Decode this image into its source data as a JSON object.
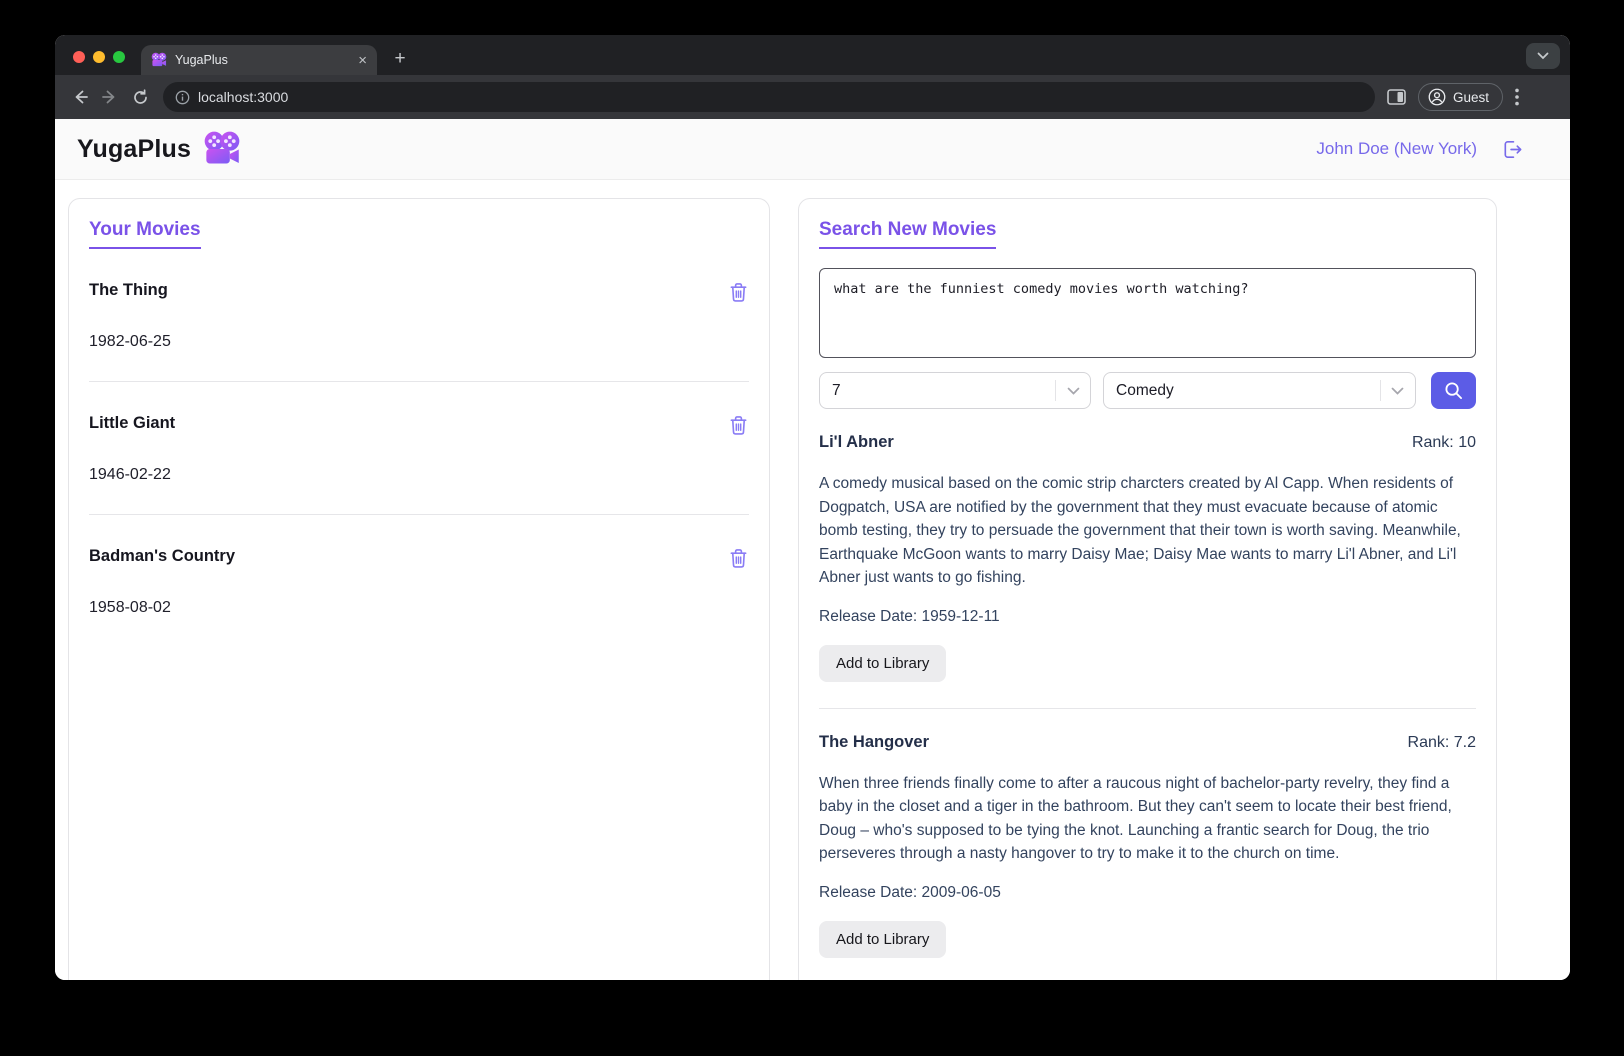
{
  "browser": {
    "tab_title": "YugaPlus",
    "tab_close": "×",
    "new_tab": "+",
    "url": "localhost:3000",
    "profile_label": "Guest"
  },
  "header": {
    "app_title": "YugaPlus",
    "user": "John Doe (New York)"
  },
  "library": {
    "title": "Your Movies",
    "movies": [
      {
        "title": "The Thing",
        "date": "1982-06-25"
      },
      {
        "title": "Little Giant",
        "date": "1946-02-22"
      },
      {
        "title": "Badman's Country",
        "date": "1958-08-02"
      }
    ]
  },
  "search": {
    "title": "Search New Movies",
    "query": "what are the funniest comedy movies worth watching?",
    "rank_value": "7",
    "genre_value": "Comedy",
    "results": [
      {
        "title": "Li'l Abner",
        "rank_label": "Rank: 10",
        "description": "A comedy musical based on the comic strip charcters created by Al Capp. When residents of Dogpatch, USA are notified by the government that they must evacuate because of atomic bomb testing, they try to persuade the government that their town is worth saving. Meanwhile, Earthquake McGoon wants to marry Daisy Mae; Daisy Mae wants to marry Li'l Abner, and Li'l Abner just wants to go fishing.",
        "release": "Release Date: 1959-12-11",
        "add_label": "Add to Library"
      },
      {
        "title": "The Hangover",
        "rank_label": "Rank: 7.2",
        "description": "When three friends finally come to after a raucous night of bachelor-party revelry, they find a baby in the closet and a tiger in the bathroom. But they can't seem to locate their best friend, Doug – who's supposed to be tying the knot. Launching a frantic search for Doug, the trio perseveres through a nasty hangover to try to make it to the church on time.",
        "release": "Release Date: 2009-06-05",
        "add_label": "Add to Library"
      }
    ]
  },
  "colors": {
    "accent_purple": "#7a52e8",
    "search_button_indigo": "#5c5ce6",
    "user_link_purple": "#7769ea",
    "trash_icon_purple": "#8a7cf5",
    "tab_strip_dark": "#202124",
    "toolbar_dark": "#35363a"
  }
}
